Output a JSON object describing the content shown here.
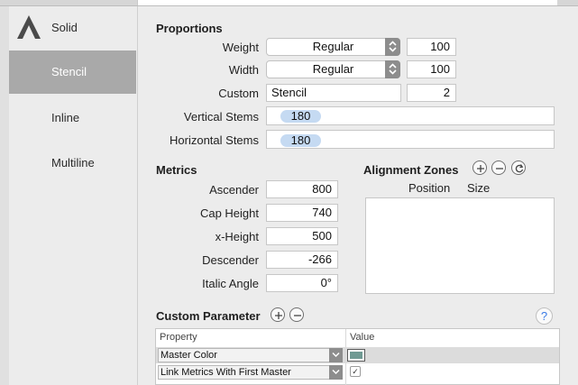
{
  "sidebar": {
    "items": [
      {
        "label": "Solid",
        "active": false
      },
      {
        "label": "Stencil",
        "active": true
      },
      {
        "label": "Inline",
        "active": false
      },
      {
        "label": "Multiline",
        "active": false
      }
    ]
  },
  "proportions": {
    "title": "Proportions",
    "weight": {
      "label": "Weight",
      "value": "Regular",
      "number": "100"
    },
    "width": {
      "label": "Width",
      "value": "Regular",
      "number": "100"
    },
    "custom": {
      "label": "Custom",
      "value": "Stencil",
      "number": "2"
    },
    "vertical_stems": {
      "label": "Vertical Stems",
      "value": "180"
    },
    "horizontal_stems": {
      "label": "Horizontal Stems",
      "value": "180"
    }
  },
  "metrics": {
    "title": "Metrics",
    "ascender": {
      "label": "Ascender",
      "value": "800"
    },
    "cap_height": {
      "label": "Cap Height",
      "value": "740"
    },
    "x_height": {
      "label": "x-Height",
      "value": "500"
    },
    "descender": {
      "label": "Descender",
      "value": "-266"
    },
    "italic_angle": {
      "label": "Italic Angle",
      "value": "0°"
    }
  },
  "alignment_zones": {
    "title": "Alignment Zones",
    "col_position": "Position",
    "col_size": "Size"
  },
  "custom_parameter": {
    "title": "Custom Parameter",
    "help": "?",
    "col_property": "Property",
    "col_value": "Value",
    "rows": [
      {
        "property": "Master Color",
        "value_type": "color",
        "color": "#6f9a93"
      },
      {
        "property": "Link Metrics With First Master",
        "value_type": "checkbox",
        "checked": true
      }
    ]
  },
  "colors": {
    "token": "#c5daf2",
    "selected_sidebar": "#a9a9a9",
    "help": "#3b7be6"
  }
}
